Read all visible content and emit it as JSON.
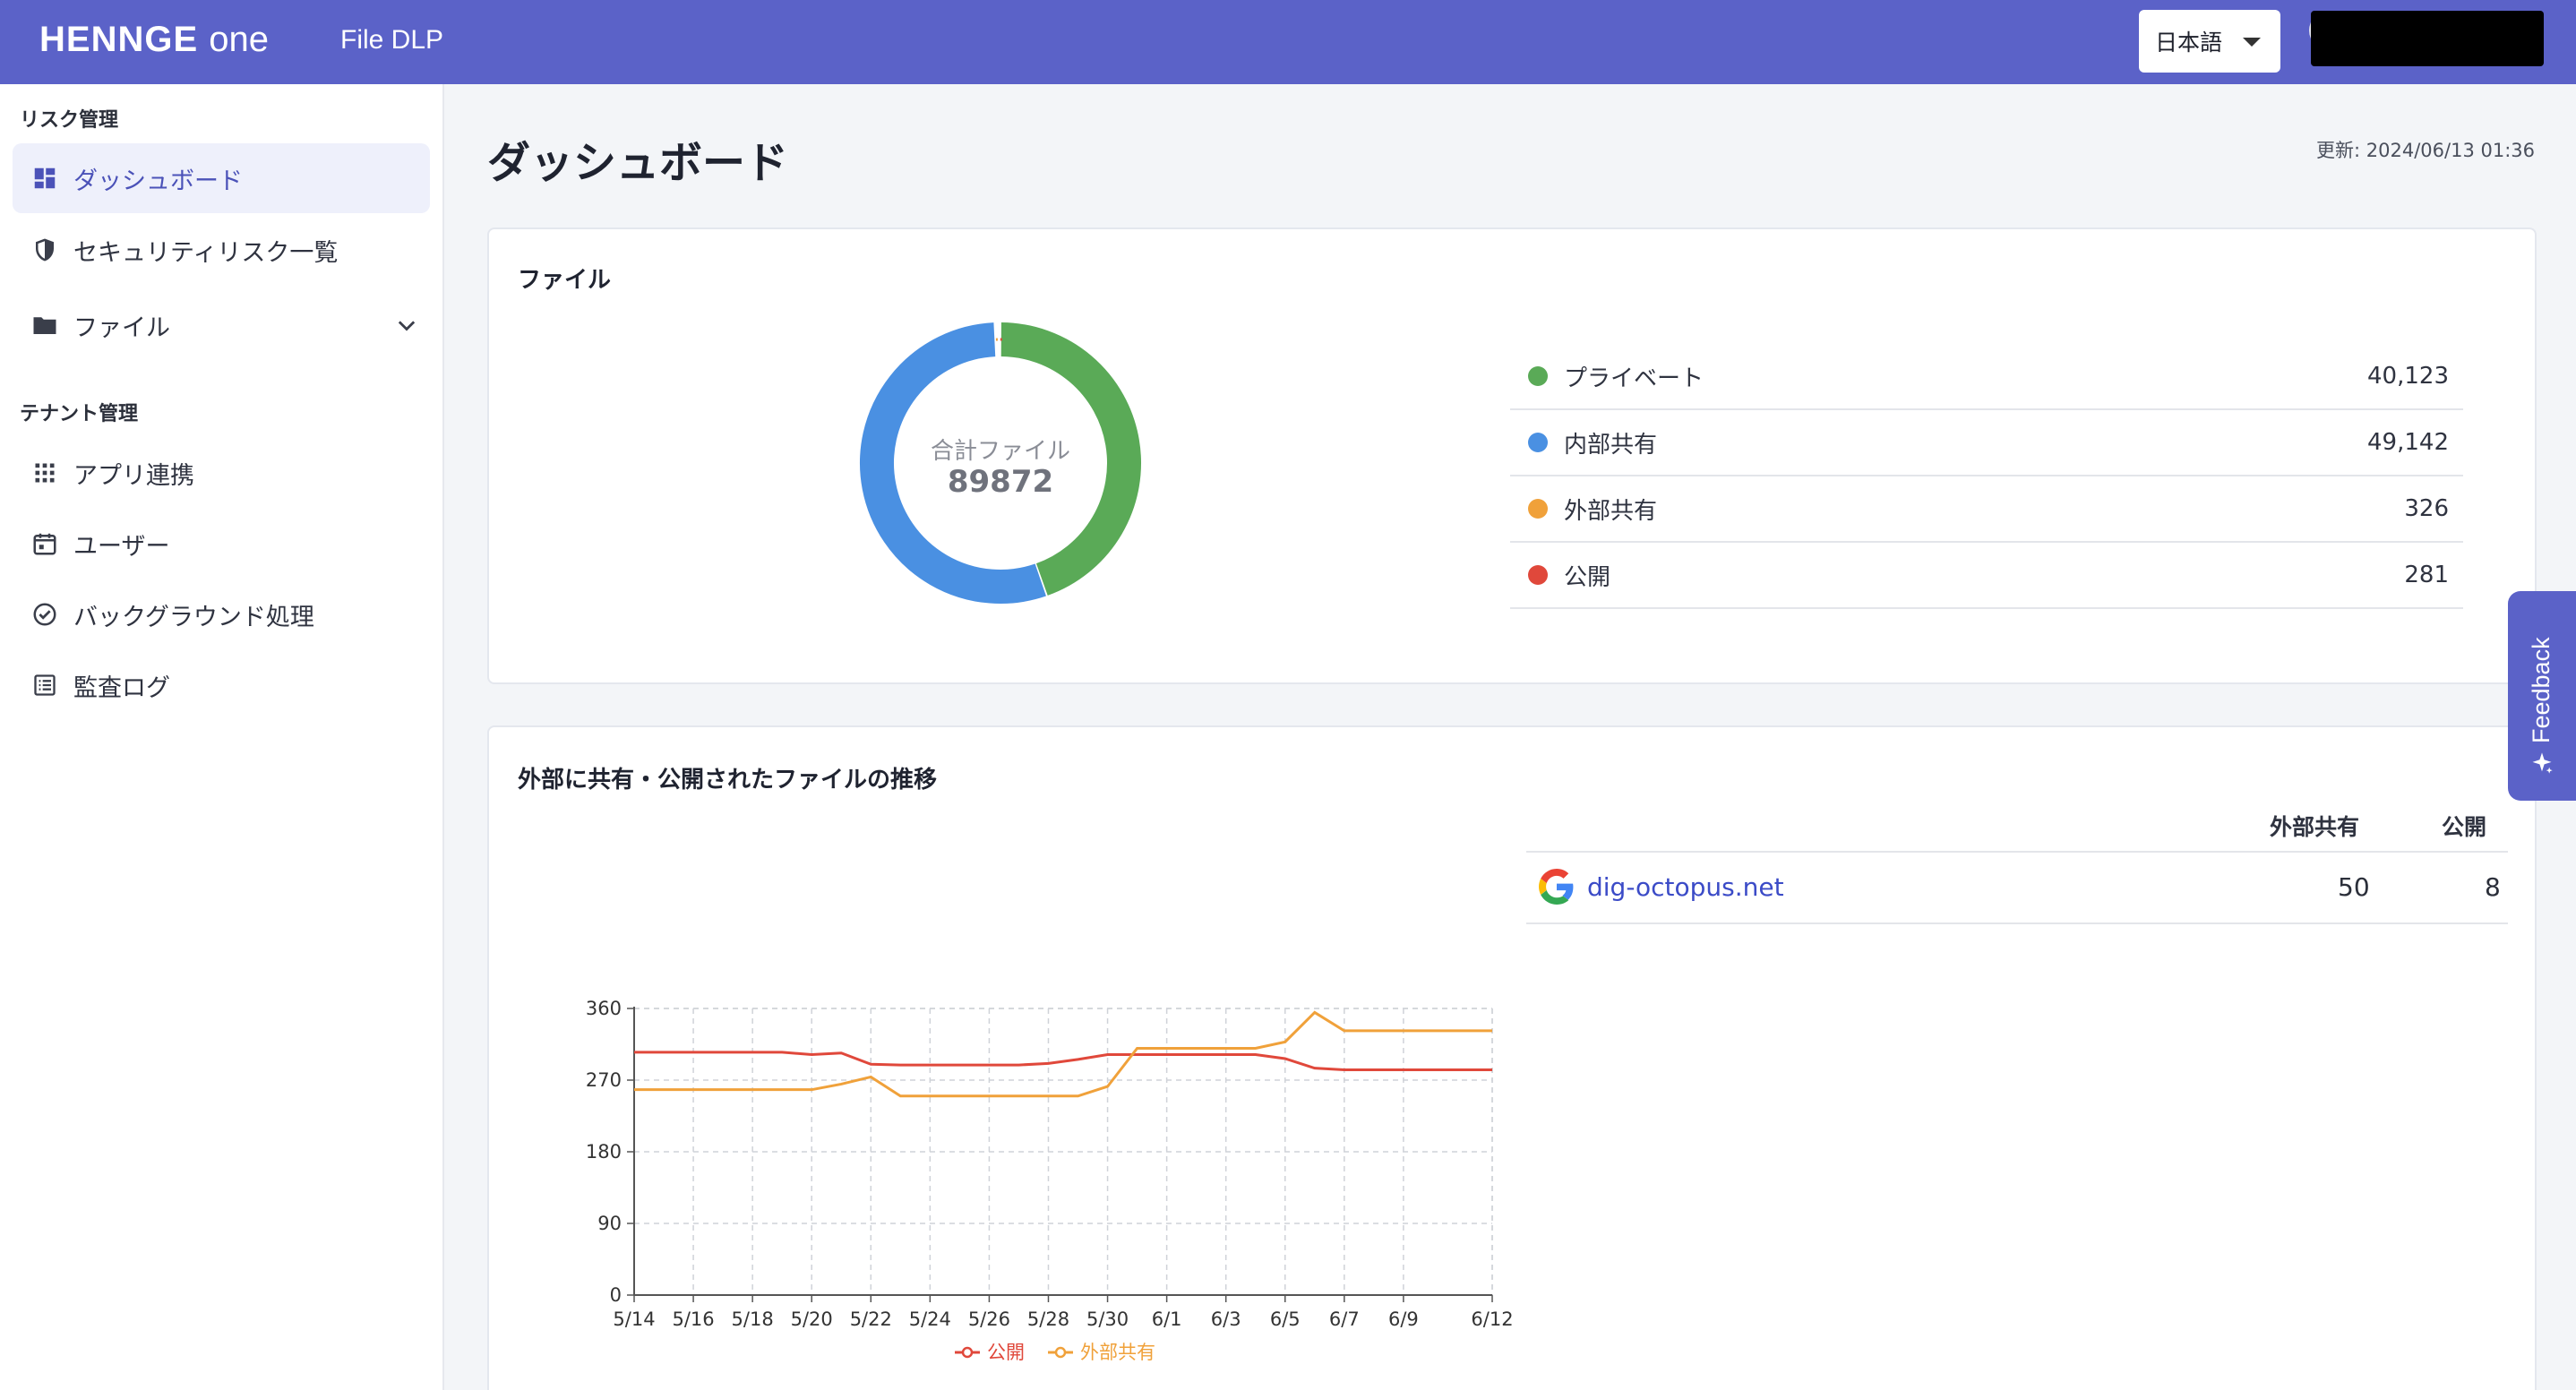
{
  "header": {
    "logo": "HENNGE",
    "logo_suffix": "One",
    "app_name": "File DLP",
    "language": "日本語"
  },
  "sidebar": {
    "risk_section": "リスク管理",
    "items": [
      {
        "label": "ダッシュボード",
        "icon": "dashboard-icon",
        "active": true
      },
      {
        "label": "セキュリティリスク一覧",
        "icon": "shield-icon"
      },
      {
        "label": "ファイル",
        "icon": "folder-icon"
      }
    ],
    "tenant_section": "テナント管理",
    "tenant_items": [
      {
        "label": "アプリ連携",
        "icon": "apps-grid-icon"
      },
      {
        "label": "ユーザー",
        "icon": "calendar-user-icon"
      },
      {
        "label": "バックグラウンド処理",
        "icon": "check-circle-icon"
      },
      {
        "label": "監査ログ",
        "icon": "list-icon"
      }
    ]
  },
  "main": {
    "title": "ダッシュボード",
    "updated": "更新: 2024/06/13 01:36"
  },
  "files_card": {
    "title": "ファイル",
    "donut_label": "合計ファイル",
    "donut_total": "89872",
    "legend": [
      {
        "label": "プライベート",
        "value": "40,123",
        "color": "#5aaa57"
      },
      {
        "label": "内部共有",
        "value": "49,142",
        "color": "#4a90e2"
      },
      {
        "label": "外部共有",
        "value": "326",
        "color": "#f0a13a"
      },
      {
        "label": "公開",
        "value": "281",
        "color": "#e0483b"
      }
    ]
  },
  "trend_card": {
    "title": "外部に共有・公開されたファイルの推移",
    "table": {
      "col_external": "外部共有",
      "col_public": "公開",
      "rows": [
        {
          "domain": "dig-octopus.net",
          "external": "50",
          "public": "8",
          "icon": "google-icon"
        }
      ]
    }
  },
  "feedback": {
    "label": "Feedback"
  },
  "chart_data": [
    {
      "type": "pie",
      "title": "",
      "labels": [
        "プライベート",
        "内部共有",
        "外部共有",
        "公開"
      ],
      "values": [
        40123,
        49142,
        326,
        281
      ],
      "colors": [
        "#5aaa57",
        "#4a90e2",
        "#f0a13a",
        "#e0483b"
      ]
    },
    {
      "type": "line",
      "title": "",
      "x": [
        "5/14",
        "5/15",
        "5/16",
        "5/17",
        "5/18",
        "5/19",
        "5/20",
        "5/21",
        "5/22",
        "5/23",
        "5/24",
        "5/25",
        "5/26",
        "5/27",
        "5/28",
        "5/29",
        "5/30",
        "5/31",
        "6/1",
        "6/2",
        "6/3",
        "6/4",
        "6/5",
        "6/6",
        "6/7",
        "6/8",
        "6/9",
        "6/10",
        "6/11",
        "6/12"
      ],
      "x_ticks": [
        "5/14",
        "5/16",
        "5/18",
        "5/20",
        "5/22",
        "5/24",
        "5/26",
        "5/28",
        "5/30",
        "6/1",
        "6/3",
        "6/5",
        "6/7",
        "6/9",
        "6/12"
      ],
      "ylim": [
        0,
        360
      ],
      "y_ticks": [
        0,
        90,
        180,
        270,
        360
      ],
      "grid": true,
      "legend_position": "bottom",
      "series": [
        {
          "name": "公開",
          "color": "#e0483b",
          "values": [
            305,
            305,
            305,
            305,
            305,
            305,
            302,
            304,
            290,
            289,
            289,
            289,
            289,
            289,
            291,
            296,
            302,
            302,
            302,
            302,
            302,
            302,
            297,
            285,
            283,
            283,
            283,
            283,
            283,
            283
          ]
        },
        {
          "name": "外部共有",
          "color": "#f0a13a",
          "values": [
            258,
            258,
            258,
            258,
            258,
            258,
            258,
            265,
            274,
            250,
            250,
            250,
            250,
            250,
            250,
            250,
            262,
            310,
            310,
            310,
            310,
            310,
            318,
            355,
            332,
            332,
            332,
            332,
            332,
            332
          ]
        }
      ]
    }
  ]
}
